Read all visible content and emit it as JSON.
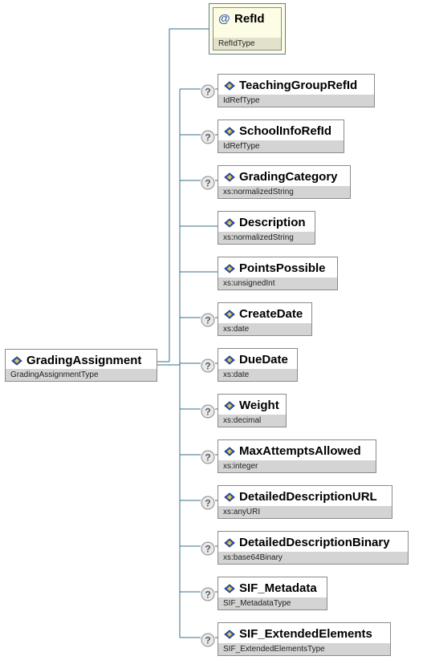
{
  "root": {
    "name": "GradingAssignment",
    "type": "GradingAssignmentType"
  },
  "attribute": {
    "name": "RefId",
    "type": "RefIdType",
    "icon": "at-sign-icon"
  },
  "optional_marker": "?",
  "elements": [
    {
      "name": "TeachingGroupRefId",
      "type": "IdRefType",
      "optional": true
    },
    {
      "name": "SchoolInfoRefId",
      "type": "IdRefType",
      "optional": true
    },
    {
      "name": "GradingCategory",
      "type": "xs:normalizedString",
      "optional": true
    },
    {
      "name": "Description",
      "type": "xs:normalizedString",
      "optional": false
    },
    {
      "name": "PointsPossible",
      "type": "xs:unsignedInt",
      "optional": false
    },
    {
      "name": "CreateDate",
      "type": "xs:date",
      "optional": true
    },
    {
      "name": "DueDate",
      "type": "xs:date",
      "optional": true
    },
    {
      "name": "Weight",
      "type": "xs:decimal",
      "optional": true
    },
    {
      "name": "MaxAttemptsAllowed",
      "type": "xs:integer",
      "optional": true
    },
    {
      "name": "DetailedDescriptionURL",
      "type": "xs:anyURI",
      "optional": true
    },
    {
      "name": "DetailedDescriptionBinary",
      "type": "xs:base64Binary",
      "optional": true
    },
    {
      "name": "SIF_Metadata",
      "type": "SIF_MetadataType",
      "optional": true
    },
    {
      "name": "SIF_ExtendedElements",
      "type": "SIF_ExtendedElementsType",
      "optional": true
    }
  ]
}
